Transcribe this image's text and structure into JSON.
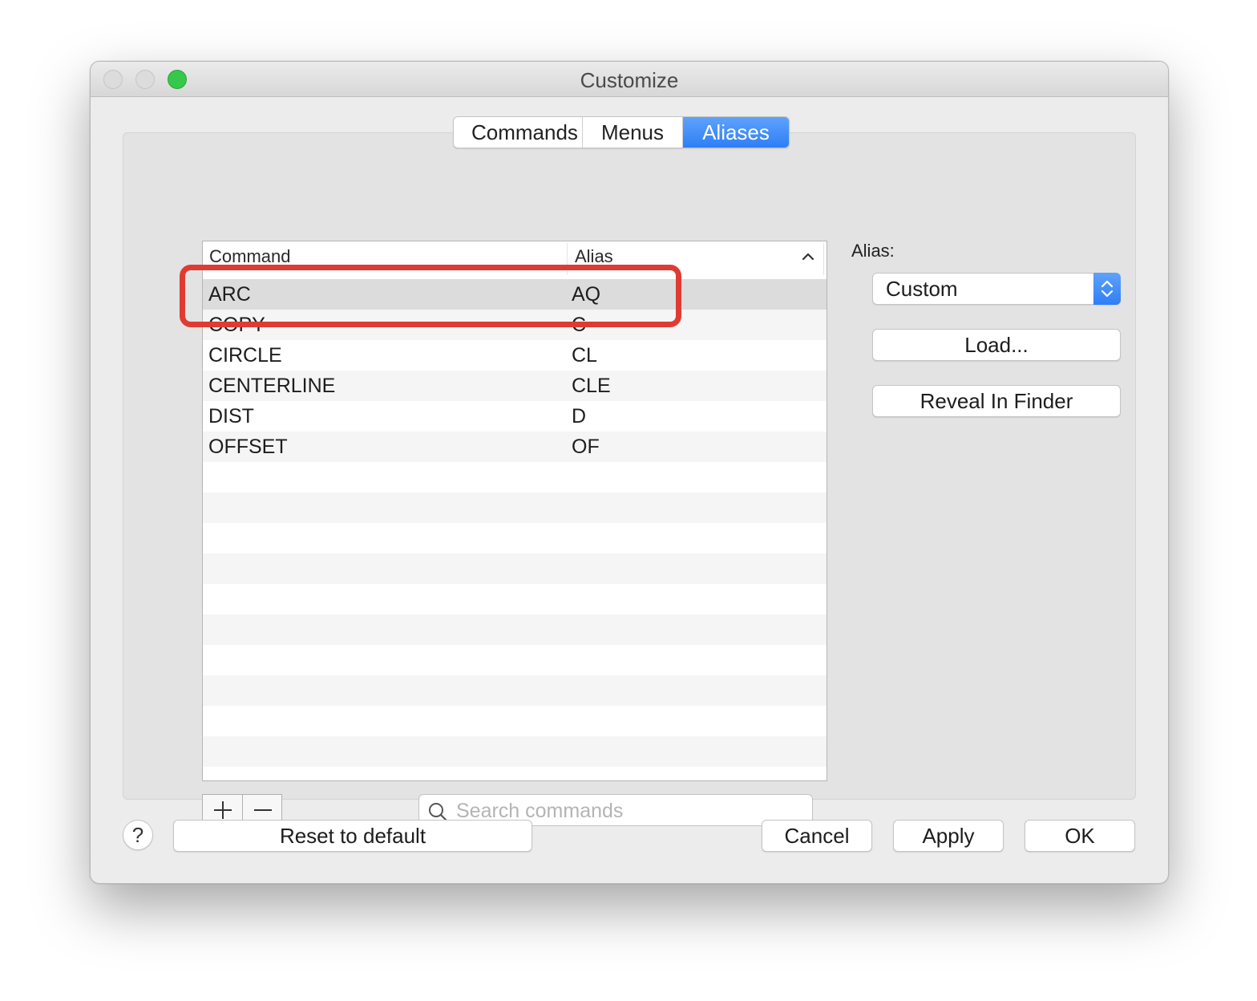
{
  "window": {
    "title": "Customize"
  },
  "tabs": [
    {
      "label": "Commands",
      "active": false
    },
    {
      "label": "Menus",
      "active": false
    },
    {
      "label": "Aliases",
      "active": true
    }
  ],
  "table": {
    "columns": {
      "command": "Command",
      "alias": "Alias"
    },
    "sort_icon": "chevron-up-icon",
    "rows": [
      {
        "command": "ARC",
        "alias": "AQ",
        "selected": true
      },
      {
        "command": "COPY",
        "alias": "C"
      },
      {
        "command": "CIRCLE",
        "alias": "CL"
      },
      {
        "command": "CENTERLINE",
        "alias": "CLE"
      },
      {
        "command": "DIST",
        "alias": "D"
      },
      {
        "command": "OFFSET",
        "alias": "OF"
      }
    ]
  },
  "controls": {
    "add_icon": "plus-icon",
    "remove_icon": "minus-icon",
    "search_icon": "search-icon",
    "search_placeholder": "Search commands"
  },
  "side": {
    "alias_label": "Alias:",
    "alias_select_value": "Custom",
    "load_label": "Load...",
    "reveal_label": "Reveal In Finder"
  },
  "footer": {
    "help_label": "?",
    "reset_label": "Reset to default",
    "cancel_label": "Cancel",
    "apply_label": "Apply",
    "ok_label": "OK"
  },
  "colors": {
    "accent": "#2d7ef7",
    "highlight_annotation": "#e03b33",
    "zoom_button": "#35c84a"
  }
}
